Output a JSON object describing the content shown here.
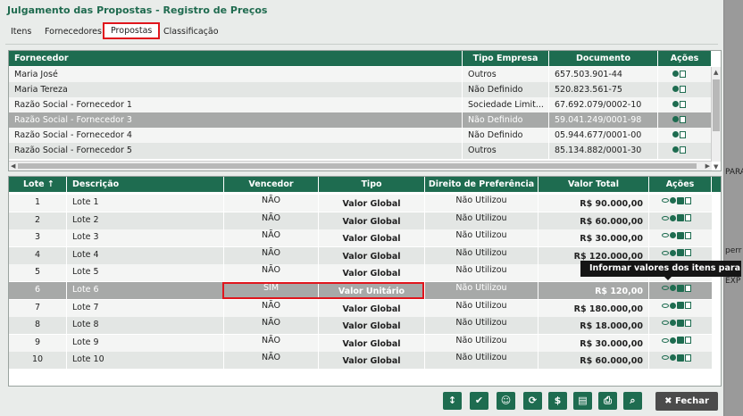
{
  "dialog": {
    "title": "Julgamento das Propostas - Registro de Preços"
  },
  "tabs": [
    "Itens",
    "Fornecedores",
    "Propostas",
    "Classificação"
  ],
  "suppliers": {
    "headers": [
      "Fornecedor",
      "Tipo Empresa",
      "Documento",
      "Ações"
    ],
    "rows": [
      [
        "Maria José",
        "Outros",
        "657.503.901-44"
      ],
      [
        "Maria Tereza",
        "Não Definido",
        "520.823.561-75"
      ],
      [
        "Razão Social - Fornecedor 1",
        "Sociedade Limit...",
        "67.692.079/0002-10"
      ],
      [
        "Razão Social - Fornecedor 3",
        "Não Definido",
        "59.041.249/0001-98"
      ],
      [
        "Razão Social - Fornecedor 4",
        "Não Definido",
        "05.944.677/0001-00"
      ],
      [
        "Razão Social - Fornecedor 5",
        "Outros",
        "85.134.882/0001-30"
      ]
    ]
  },
  "lots": {
    "headers": [
      "Lote ↑",
      "Descrição",
      "Vencedor",
      "Tipo",
      "Direito de Preferência",
      "Valor Total",
      "Ações"
    ],
    "rows": [
      [
        "1",
        "Lote 1",
        "NÃO",
        "Valor Global",
        "Não Utilizou",
        "R$ 90.000,00"
      ],
      [
        "2",
        "Lote 2",
        "NÃO",
        "Valor Global",
        "Não Utilizou",
        "R$ 60.000,00"
      ],
      [
        "3",
        "Lote 3",
        "NÃO",
        "Valor Global",
        "Não Utilizou",
        "R$ 30.000,00"
      ],
      [
        "4",
        "Lote 4",
        "NÃO",
        "Valor Global",
        "Não Utilizou",
        "R$ 120.000,00"
      ],
      [
        "5",
        "Lote 5",
        "NÃO",
        "Valor Global",
        "Não Utilizou",
        ""
      ],
      [
        "6",
        "Lote 6",
        "SIM",
        "Valor Unitário",
        "Não Utilizou",
        "R$ 120,00"
      ],
      [
        "7",
        "Lote 7",
        "NÃO",
        "Valor Global",
        "Não Utilizou",
        "R$ 180.000,00"
      ],
      [
        "8",
        "Lote 8",
        "NÃO",
        "Valor Global",
        "Não Utilizou",
        "R$ 18.000,00"
      ],
      [
        "9",
        "Lote 9",
        "NÃO",
        "Valor Global",
        "Não Utilizou",
        "R$ 30.000,00"
      ],
      [
        "10",
        "Lote 10",
        "NÃO",
        "Valor Global",
        "Não Utilizou",
        "R$ 60.000,00"
      ]
    ]
  },
  "tooltip": "Informar valores dos itens para o lote",
  "toolbar": {
    "icons": [
      "sort-icon",
      "check-icon",
      "users-icon",
      "refresh-icon",
      "dollar-icon",
      "document-icon",
      "print-icon",
      "search-icon"
    ],
    "glyphs": [
      "↕",
      "✔",
      "☺",
      "⟳",
      "$",
      "▤",
      "⎙",
      "⌕"
    ],
    "close_label": "✖ Fechar"
  },
  "background": {
    "texts": [
      "PARA",
      "perr",
      "EXP"
    ]
  }
}
